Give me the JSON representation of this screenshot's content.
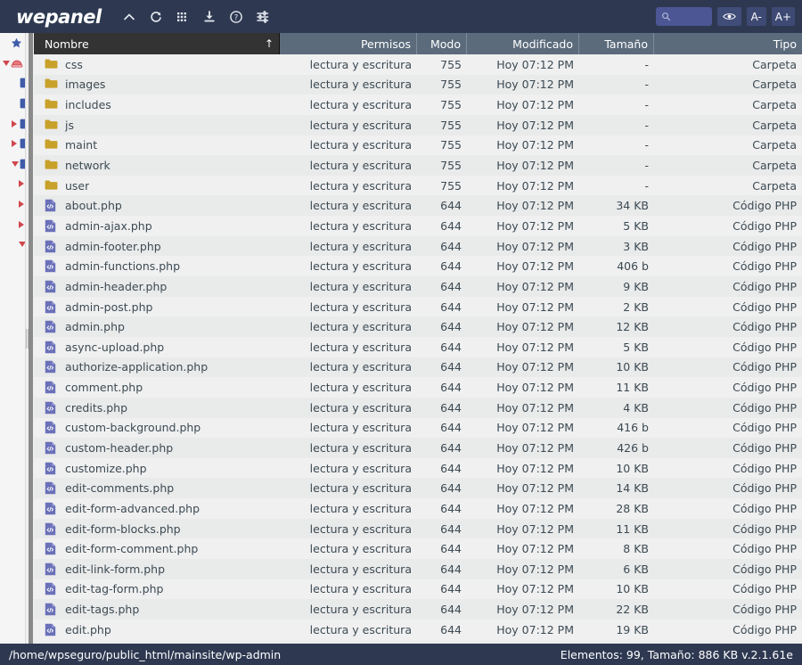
{
  "app": {
    "brand": "wepanel",
    "accent_dark": "#2e3951",
    "accent_header": "#5b6b7c",
    "folder_color": "#c8a12a",
    "php_color": "#6a71b8"
  },
  "toolbar": {
    "items": [
      {
        "name": "collapse-icon",
        "label": "Contraer"
      },
      {
        "name": "refresh-icon",
        "label": "Actualizar"
      },
      {
        "name": "grid-icon",
        "label": "Vista de cuadrícula"
      },
      {
        "name": "download-icon",
        "label": "Descargar"
      },
      {
        "name": "help-icon",
        "label": "Ayuda"
      },
      {
        "name": "settings-icon",
        "label": "Preferencias"
      }
    ]
  },
  "search": {
    "value": "",
    "placeholder": "",
    "icon": "search-icon"
  },
  "view_controls": {
    "eye_label": "",
    "zoom_out_label": "A-",
    "zoom_in_label": "A+"
  },
  "sidebar": {
    "items": [
      {
        "name": "favorites-star-icon",
        "icon": "star",
        "expander": "none"
      },
      {
        "name": "home-drive-icon",
        "icon": "drive",
        "expander": "down"
      },
      {
        "name": "folder-node",
        "icon": "folder",
        "expander": "none"
      },
      {
        "name": "folder-node",
        "icon": "folder",
        "expander": "none"
      },
      {
        "name": "folder-node",
        "icon": "folder",
        "expander": "right"
      },
      {
        "name": "folder-node",
        "icon": "folder",
        "expander": "right"
      },
      {
        "name": "folder-node",
        "icon": "folder",
        "expander": "down"
      },
      {
        "name": "folder-node",
        "icon": "none",
        "expander": "right"
      },
      {
        "name": "folder-node",
        "icon": "none",
        "expander": "right"
      },
      {
        "name": "folder-node",
        "icon": "none",
        "expander": "right"
      },
      {
        "name": "folder-node",
        "icon": "none",
        "expander": "down"
      }
    ]
  },
  "columns": [
    {
      "key": "name",
      "label": "Nombre",
      "align": "left",
      "sort": "asc",
      "sort_glyph": "↑"
    },
    {
      "key": "perms",
      "label": "Permisos",
      "align": "right"
    },
    {
      "key": "mode",
      "label": "Modo",
      "align": "right"
    },
    {
      "key": "modified",
      "label": "Modificado",
      "align": "right"
    },
    {
      "key": "size",
      "label": "Tamaño",
      "align": "right"
    },
    {
      "key": "type",
      "label": "Tipo",
      "align": "right"
    }
  ],
  "rows": [
    {
      "icon": "folder",
      "name": "css",
      "perms": "lectura y escritura",
      "mode": "755",
      "modified": "Hoy 07:12 PM",
      "size": "-",
      "type": "Carpeta"
    },
    {
      "icon": "folder",
      "name": "images",
      "perms": "lectura y escritura",
      "mode": "755",
      "modified": "Hoy 07:12 PM",
      "size": "-",
      "type": "Carpeta"
    },
    {
      "icon": "folder",
      "name": "includes",
      "perms": "lectura y escritura",
      "mode": "755",
      "modified": "Hoy 07:12 PM",
      "size": "-",
      "type": "Carpeta"
    },
    {
      "icon": "folder",
      "name": "js",
      "perms": "lectura y escritura",
      "mode": "755",
      "modified": "Hoy 07:12 PM",
      "size": "-",
      "type": "Carpeta"
    },
    {
      "icon": "folder",
      "name": "maint",
      "perms": "lectura y escritura",
      "mode": "755",
      "modified": "Hoy 07:12 PM",
      "size": "-",
      "type": "Carpeta"
    },
    {
      "icon": "folder",
      "name": "network",
      "perms": "lectura y escritura",
      "mode": "755",
      "modified": "Hoy 07:12 PM",
      "size": "-",
      "type": "Carpeta"
    },
    {
      "icon": "folder",
      "name": "user",
      "perms": "lectura y escritura",
      "mode": "755",
      "modified": "Hoy 07:12 PM",
      "size": "-",
      "type": "Carpeta"
    },
    {
      "icon": "php",
      "name": "about.php",
      "perms": "lectura y escritura",
      "mode": "644",
      "modified": "Hoy 07:12 PM",
      "size": "34 KB",
      "type": "Código PHP"
    },
    {
      "icon": "php",
      "name": "admin-ajax.php",
      "perms": "lectura y escritura",
      "mode": "644",
      "modified": "Hoy 07:12 PM",
      "size": "5 KB",
      "type": "Código PHP"
    },
    {
      "icon": "php",
      "name": "admin-footer.php",
      "perms": "lectura y escritura",
      "mode": "644",
      "modified": "Hoy 07:12 PM",
      "size": "3 KB",
      "type": "Código PHP"
    },
    {
      "icon": "php",
      "name": "admin-functions.php",
      "perms": "lectura y escritura",
      "mode": "644",
      "modified": "Hoy 07:12 PM",
      "size": "406 b",
      "type": "Código PHP"
    },
    {
      "icon": "php",
      "name": "admin-header.php",
      "perms": "lectura y escritura",
      "mode": "644",
      "modified": "Hoy 07:12 PM",
      "size": "9 KB",
      "type": "Código PHP"
    },
    {
      "icon": "php",
      "name": "admin-post.php",
      "perms": "lectura y escritura",
      "mode": "644",
      "modified": "Hoy 07:12 PM",
      "size": "2 KB",
      "type": "Código PHP"
    },
    {
      "icon": "php",
      "name": "admin.php",
      "perms": "lectura y escritura",
      "mode": "644",
      "modified": "Hoy 07:12 PM",
      "size": "12 KB",
      "type": "Código PHP"
    },
    {
      "icon": "php",
      "name": "async-upload.php",
      "perms": "lectura y escritura",
      "mode": "644",
      "modified": "Hoy 07:12 PM",
      "size": "5 KB",
      "type": "Código PHP"
    },
    {
      "icon": "php",
      "name": "authorize-application.php",
      "perms": "lectura y escritura",
      "mode": "644",
      "modified": "Hoy 07:12 PM",
      "size": "10 KB",
      "type": "Código PHP"
    },
    {
      "icon": "php",
      "name": "comment.php",
      "perms": "lectura y escritura",
      "mode": "644",
      "modified": "Hoy 07:12 PM",
      "size": "11 KB",
      "type": "Código PHP"
    },
    {
      "icon": "php",
      "name": "credits.php",
      "perms": "lectura y escritura",
      "mode": "644",
      "modified": "Hoy 07:12 PM",
      "size": "4 KB",
      "type": "Código PHP"
    },
    {
      "icon": "php",
      "name": "custom-background.php",
      "perms": "lectura y escritura",
      "mode": "644",
      "modified": "Hoy 07:12 PM",
      "size": "416 b",
      "type": "Código PHP"
    },
    {
      "icon": "php",
      "name": "custom-header.php",
      "perms": "lectura y escritura",
      "mode": "644",
      "modified": "Hoy 07:12 PM",
      "size": "426 b",
      "type": "Código PHP"
    },
    {
      "icon": "php",
      "name": "customize.php",
      "perms": "lectura y escritura",
      "mode": "644",
      "modified": "Hoy 07:12 PM",
      "size": "10 KB",
      "type": "Código PHP"
    },
    {
      "icon": "php",
      "name": "edit-comments.php",
      "perms": "lectura y escritura",
      "mode": "644",
      "modified": "Hoy 07:12 PM",
      "size": "14 KB",
      "type": "Código PHP"
    },
    {
      "icon": "php",
      "name": "edit-form-advanced.php",
      "perms": "lectura y escritura",
      "mode": "644",
      "modified": "Hoy 07:12 PM",
      "size": "28 KB",
      "type": "Código PHP"
    },
    {
      "icon": "php",
      "name": "edit-form-blocks.php",
      "perms": "lectura y escritura",
      "mode": "644",
      "modified": "Hoy 07:12 PM",
      "size": "11 KB",
      "type": "Código PHP"
    },
    {
      "icon": "php",
      "name": "edit-form-comment.php",
      "perms": "lectura y escritura",
      "mode": "644",
      "modified": "Hoy 07:12 PM",
      "size": "8 KB",
      "type": "Código PHP"
    },
    {
      "icon": "php",
      "name": "edit-link-form.php",
      "perms": "lectura y escritura",
      "mode": "644",
      "modified": "Hoy 07:12 PM",
      "size": "6 KB",
      "type": "Código PHP"
    },
    {
      "icon": "php",
      "name": "edit-tag-form.php",
      "perms": "lectura y escritura",
      "mode": "644",
      "modified": "Hoy 07:12 PM",
      "size": "10 KB",
      "type": "Código PHP"
    },
    {
      "icon": "php",
      "name": "edit-tags.php",
      "perms": "lectura y escritura",
      "mode": "644",
      "modified": "Hoy 07:12 PM",
      "size": "22 KB",
      "type": "Código PHP"
    },
    {
      "icon": "php",
      "name": "edit.php",
      "perms": "lectura y escritura",
      "mode": "644",
      "modified": "Hoy 07:12 PM",
      "size": "19 KB",
      "type": "Código PHP"
    }
  ],
  "status": {
    "path": "/home/wpseguro/public_html/mainsite/wp-admin",
    "summary": "Elementos: 99, Tamaño: 886 KB v.2.1.61e"
  }
}
